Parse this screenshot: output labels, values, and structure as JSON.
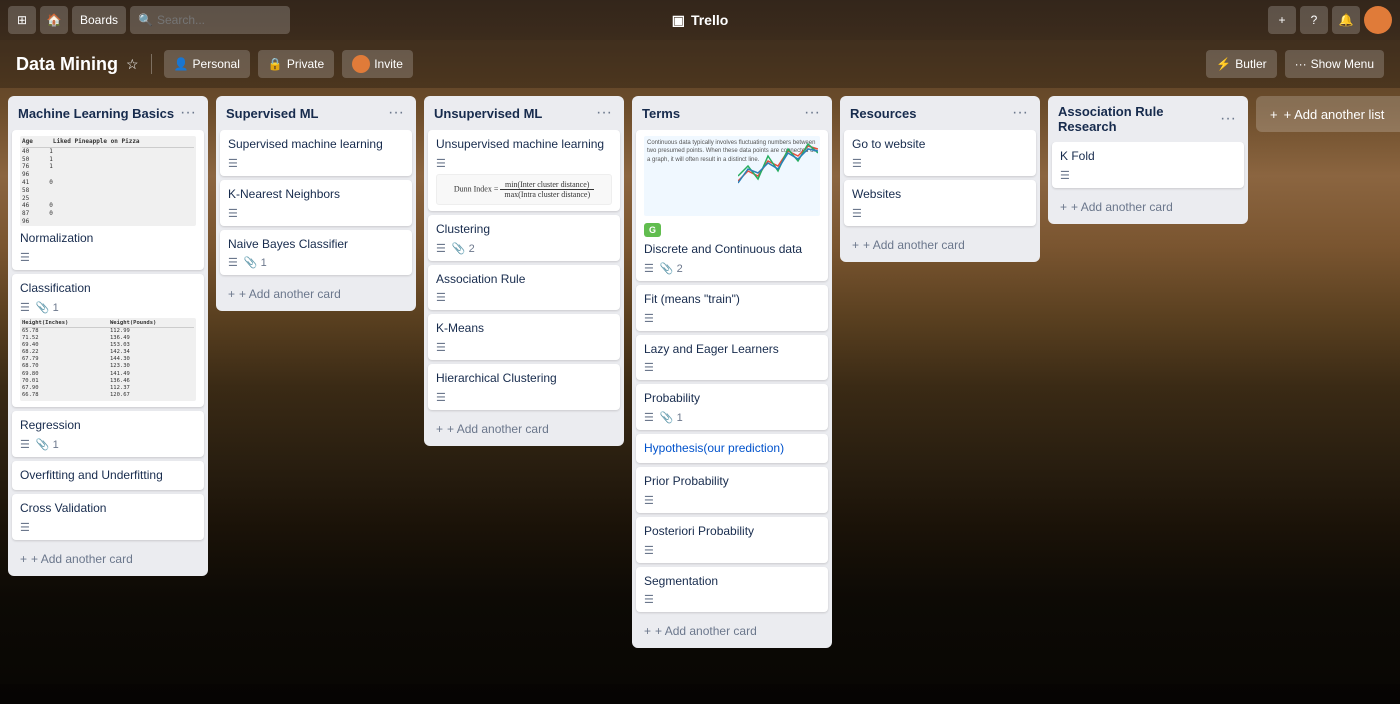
{
  "app": {
    "name": "Trello"
  },
  "topnav": {
    "buttons": [
      "⊞",
      "🏠",
      "☰"
    ],
    "search_placeholder": "Search...",
    "board_label": "Boards",
    "add_icon": "+",
    "info_icon": "?",
    "bell_icon": "🔔",
    "show_menu": "Show Menu"
  },
  "board": {
    "title": "Data Mining",
    "personal_label": "Personal",
    "private_label": "Private",
    "invite_label": "Invite",
    "butler_label": "Butler",
    "show_menu_label": "Show Menu"
  },
  "lists": [
    {
      "id": "ml-basics",
      "title": "Machine Learning Basics",
      "cards": [
        {
          "id": "normalization",
          "title": "Normalization",
          "has_desc": true,
          "image": true
        },
        {
          "id": "classification",
          "title": "Classification",
          "has_desc": true,
          "attachments": 1,
          "data_table": true
        },
        {
          "id": "regression",
          "title": "Regression",
          "has_desc": true,
          "attachments": 1
        },
        {
          "id": "overfitting",
          "title": "Overfitting and Underfitting",
          "has_desc": false
        },
        {
          "id": "cross-val",
          "title": "Cross Validation",
          "has_desc": false
        }
      ],
      "add_label": "+ Add another card"
    },
    {
      "id": "supervised-ml",
      "title": "Supervised ML",
      "cards": [
        {
          "id": "sup-ml",
          "title": "Supervised machine learning",
          "has_desc": true
        },
        {
          "id": "knn",
          "title": "K-Nearest Neighbors",
          "has_desc": true
        },
        {
          "id": "naive-bayes",
          "title": "Naive Bayes Classifier",
          "has_desc": true,
          "attachments": 1
        }
      ],
      "add_label": "+ Add another card"
    },
    {
      "id": "unsupervised-ml",
      "title": "Unsupervised ML",
      "cards": [
        {
          "id": "unsup-ml",
          "title": "Unsupervised machine learning",
          "has_desc": true,
          "formula": true
        },
        {
          "id": "clustering",
          "title": "Clustering",
          "has_desc": true,
          "attachments": 2
        },
        {
          "id": "assoc-rule",
          "title": "Association Rule",
          "has_desc": true
        },
        {
          "id": "kmeans",
          "title": "K-Means",
          "has_desc": true
        },
        {
          "id": "hierarchical",
          "title": "Hierarchical Clustering",
          "has_desc": true
        }
      ],
      "add_label": "+ Add another card"
    },
    {
      "id": "terms",
      "title": "Terms",
      "cards": [
        {
          "id": "disc-cont",
          "title": "Discrete and Continuous data",
          "has_desc": true,
          "attachments": 2,
          "label": "G",
          "graph": true
        },
        {
          "id": "fit-train",
          "title": "Fit (means \"train\")",
          "has_desc": true
        },
        {
          "id": "lazy-eager",
          "title": "Lazy and Eager Learners",
          "has_desc": true
        },
        {
          "id": "probability",
          "title": "Probability",
          "has_desc": true,
          "attachments": 1
        },
        {
          "id": "hypothesis",
          "title": "Hypothesis(our prediction)",
          "has_desc": false,
          "link": true
        },
        {
          "id": "prior-prob",
          "title": "Prior Probability",
          "has_desc": true
        },
        {
          "id": "posteriori",
          "title": "Posteriori Probability",
          "has_desc": true
        },
        {
          "id": "segmentation",
          "title": "Segmentation",
          "has_desc": true
        }
      ],
      "add_label": "+ Add another card"
    },
    {
      "id": "resources",
      "title": "Resources",
      "cards": [
        {
          "id": "go-website",
          "title": "Go to website",
          "has_desc": true
        },
        {
          "id": "websites",
          "title": "Websites",
          "has_desc": true
        }
      ],
      "add_label": "+ Add another card"
    },
    {
      "id": "assoc-rule-research",
      "title": "Association Rule Research",
      "cards": [
        {
          "id": "k-fold",
          "title": "K Fold",
          "has_desc": true
        }
      ],
      "add_label": "+ Add another card"
    }
  ],
  "add_list_label": "+ Add another list"
}
